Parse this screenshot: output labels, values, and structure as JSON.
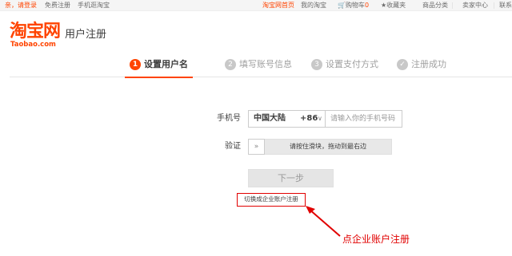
{
  "topbar": {
    "greeting": "亲，请登录",
    "register": "免费注册",
    "mobile": "手机逛淘宝",
    "home": "淘宝网首页",
    "my_taobao": "我的淘宝",
    "cart": "购物车",
    "cart_count": "0",
    "favorites": "收藏夹",
    "categories": "商品分类",
    "seller_center": "卖家中心",
    "contact": "联系"
  },
  "header": {
    "logo_cn": "淘宝网",
    "logo_en": "Taobao.com",
    "title": "用户注册"
  },
  "steps": [
    {
      "num": "1",
      "label": "设置用户名",
      "active": true
    },
    {
      "num": "2",
      "label": "填写账号信息",
      "active": false
    },
    {
      "num": "3",
      "label": "设置支付方式",
      "active": false
    },
    {
      "num": "✓",
      "label": "注册成功",
      "active": false
    }
  ],
  "form": {
    "phone_label": "手机号",
    "region_name": "中国大陆",
    "region_code": "+86",
    "phone_placeholder": "请输入你的手机号码",
    "verify_label": "验证",
    "slider_handle": "»",
    "slider_hint": "请按住滑块，拖动到最右边",
    "next_label": "下一步",
    "enterprise_link": "切换成企业账户注册"
  },
  "annotation": {
    "text": "点企业账户注册",
    "color": "#e10000"
  },
  "colors": {
    "brand": "#ff4400",
    "annotation": "#e10000"
  }
}
